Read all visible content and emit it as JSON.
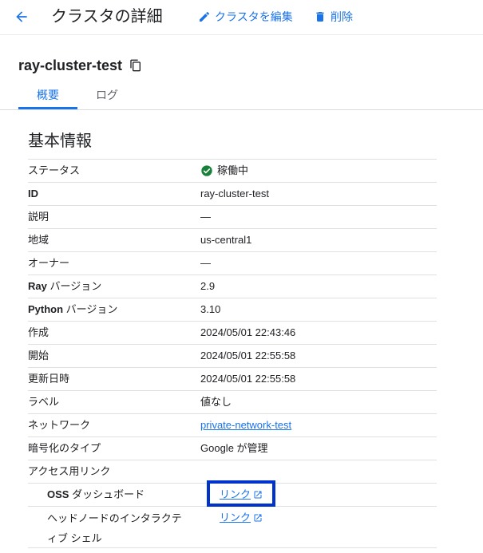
{
  "header": {
    "title": "クラスタの詳細",
    "edit_label": "クラスタを編集",
    "delete_label": "削除"
  },
  "cluster": {
    "name": "ray-cluster-test"
  },
  "tabs": [
    {
      "label": "概要",
      "active": true
    },
    {
      "label": "ログ",
      "active": false
    }
  ],
  "section": {
    "title": "基本情報"
  },
  "details": {
    "status": {
      "label": "ステータス",
      "value": "稼働中"
    },
    "id": {
      "label": "ID",
      "value": "ray-cluster-test"
    },
    "description": {
      "label": "説明",
      "value": "—"
    },
    "region": {
      "label": "地域",
      "value": "us-central1"
    },
    "owner": {
      "label": "オーナー",
      "value": "—"
    },
    "ray_version": {
      "label_bold": "Ray",
      "label_rest": " バージョン",
      "value": "2.9"
    },
    "python_version": {
      "label_bold": "Python",
      "label_rest": " バージョン",
      "value": "3.10"
    },
    "created": {
      "label": "作成",
      "value": "2024/05/01 22:43:46"
    },
    "started": {
      "label": "開始",
      "value": "2024/05/01 22:55:58"
    },
    "updated": {
      "label": "更新日時",
      "value": "2024/05/01 22:55:58"
    },
    "labels": {
      "label": "ラベル",
      "value": "値なし"
    },
    "network": {
      "label": "ネットワーク",
      "value": "private-network-test"
    },
    "encryption": {
      "label": "暗号化のタイプ",
      "value": "Google が管理"
    },
    "access_links": {
      "label": "アクセス用リンク"
    },
    "oss_dashboard": {
      "label_bold": "OSS",
      "label_rest": " ダッシュボード",
      "link": "リンク"
    },
    "head_node_shell": {
      "label": "ヘッドノードのインタラクティブ シェル",
      "link": "リンク"
    }
  },
  "colors": {
    "accent": "#1a73e8",
    "status_ok": "#188038",
    "highlight": "#0033cc"
  },
  "icons": {
    "back": "arrow-back-icon",
    "edit": "pencil-icon",
    "delete": "trash-icon",
    "copy": "copy-icon",
    "status": "check-circle-icon",
    "external": "open-in-new-icon"
  }
}
